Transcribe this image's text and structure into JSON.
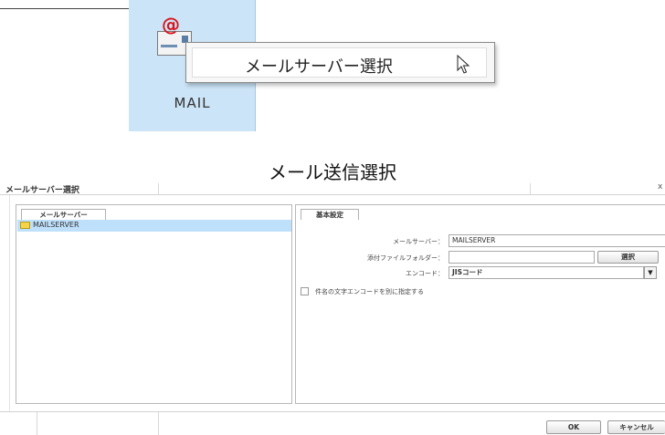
{
  "tile": {
    "label": "MAIL",
    "icon": "mail-envelope-icon",
    "at_symbol": "@"
  },
  "popup": {
    "label": "メールサーバー選択",
    "cursor_icon": "mouse-cursor-icon"
  },
  "section_title": "メール送信選択",
  "dialog": {
    "title": "メールサーバー選択",
    "close": "x",
    "left_panel": {
      "tab": "メールサーバー",
      "items": [
        {
          "label": "MAILSERVER",
          "icon": "mail-icon"
        }
      ]
    },
    "right_panel": {
      "tab": "基本設定",
      "mail_server_label": "メールサーバー：",
      "mail_server_value": "MAILSERVER",
      "attach_folder_label": "添付ファイルフォルダー：",
      "attach_folder_value": "",
      "select_button": "選択",
      "encode_label": "エンコード：",
      "encode_value": "JISコード",
      "subject_encode_checkbox": "件名の文字エンコードを別に指定する",
      "subject_encode_checked": false
    },
    "footer": {
      "ok": "OK",
      "cancel": "キャンセル"
    }
  },
  "colors": {
    "tile_bg": "#cce4f7",
    "selected_row": "#bfe0fb",
    "at_red": "#d6141b"
  }
}
